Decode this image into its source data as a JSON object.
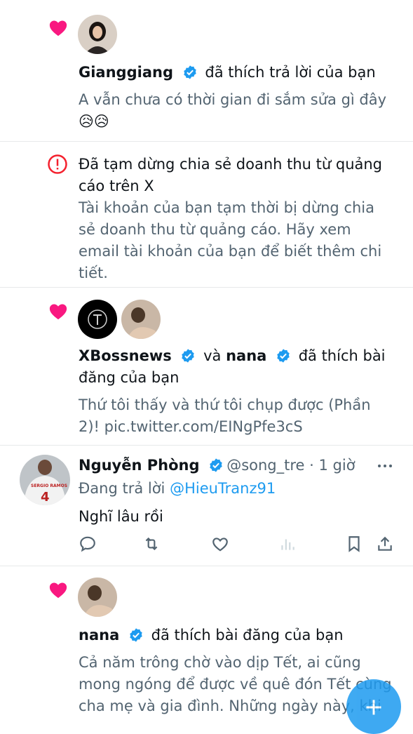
{
  "colors": {
    "heart": "#f91880",
    "verified": "#1d9bf0",
    "text_secondary": "#536471",
    "link": "#1d9bf0",
    "alert": "#f4212e"
  },
  "notif1": {
    "user": "Gianggiang",
    "action": "đã thích trả lời của bạn",
    "text": "A vẫn chưa có thời gian đi sắm sửa gì đây",
    "emoji": "😥😥"
  },
  "notif2": {
    "title_line1": "Đã tạm dừng chia sẻ doanh thu từ quảng",
    "title_line2": "cáo trên X",
    "body_line1": "Tài khoản của bạn tạm thời bị dừng chia",
    "body_line2": "sẻ doanh thu từ quảng cáo. Hãy xem",
    "body_line3": "email tài khoản của bạn để biết thêm chi",
    "body_line4": "tiết."
  },
  "notif3": {
    "user1": "XBossnews",
    "conj": "và",
    "user2": "nana",
    "action_part1": "đã thích bài",
    "action_part2": "đăng của bạn",
    "text_line1": "Thứ tôi thấy và thứ tôi chụp được (Phần",
    "text_line2": "2)! pic.twitter.com/EINgPfe3cS"
  },
  "reply": {
    "name": "Nguyễn Phòng",
    "handle": "@song_tre",
    "time": "· 1 giờ",
    "replying_label": "Đang trả lời",
    "replying_to": "@HieuTranz91",
    "text": "Nghĩ lâu rồi"
  },
  "notif5": {
    "user": "nana",
    "action": "đã thích bài đăng của bạn",
    "text_line1": "Cả năm trông chờ vào dịp Tết, ai cũng",
    "text_line2": "mong ngóng để được về quê đón Tết cùng",
    "text_line3": "cha mẹ và gia đình. Những ngày này, khi"
  }
}
